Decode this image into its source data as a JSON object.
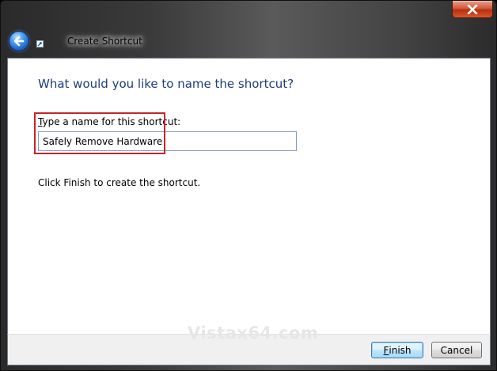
{
  "window": {
    "title": "Create Shortcut"
  },
  "icons": {
    "back": "back-arrow-icon",
    "close": "close-icon",
    "shortcut": "shortcut-icon"
  },
  "main": {
    "heading": "What would you like to name the shortcut?",
    "field_label_accesskey": "T",
    "field_label_rest": "ype a name for this shortcut:",
    "name_value": "Safely Remove Hardware",
    "finish_hint": "Click Finish to create the shortcut."
  },
  "buttons": {
    "finish_accesskey": "F",
    "finish_rest": "inish",
    "cancel": "Cancel"
  },
  "watermark": "Vistax64.com",
  "colors": {
    "heading": "#1e3d7a",
    "highlight": "#c8232c",
    "close_button": "#c8401f"
  }
}
